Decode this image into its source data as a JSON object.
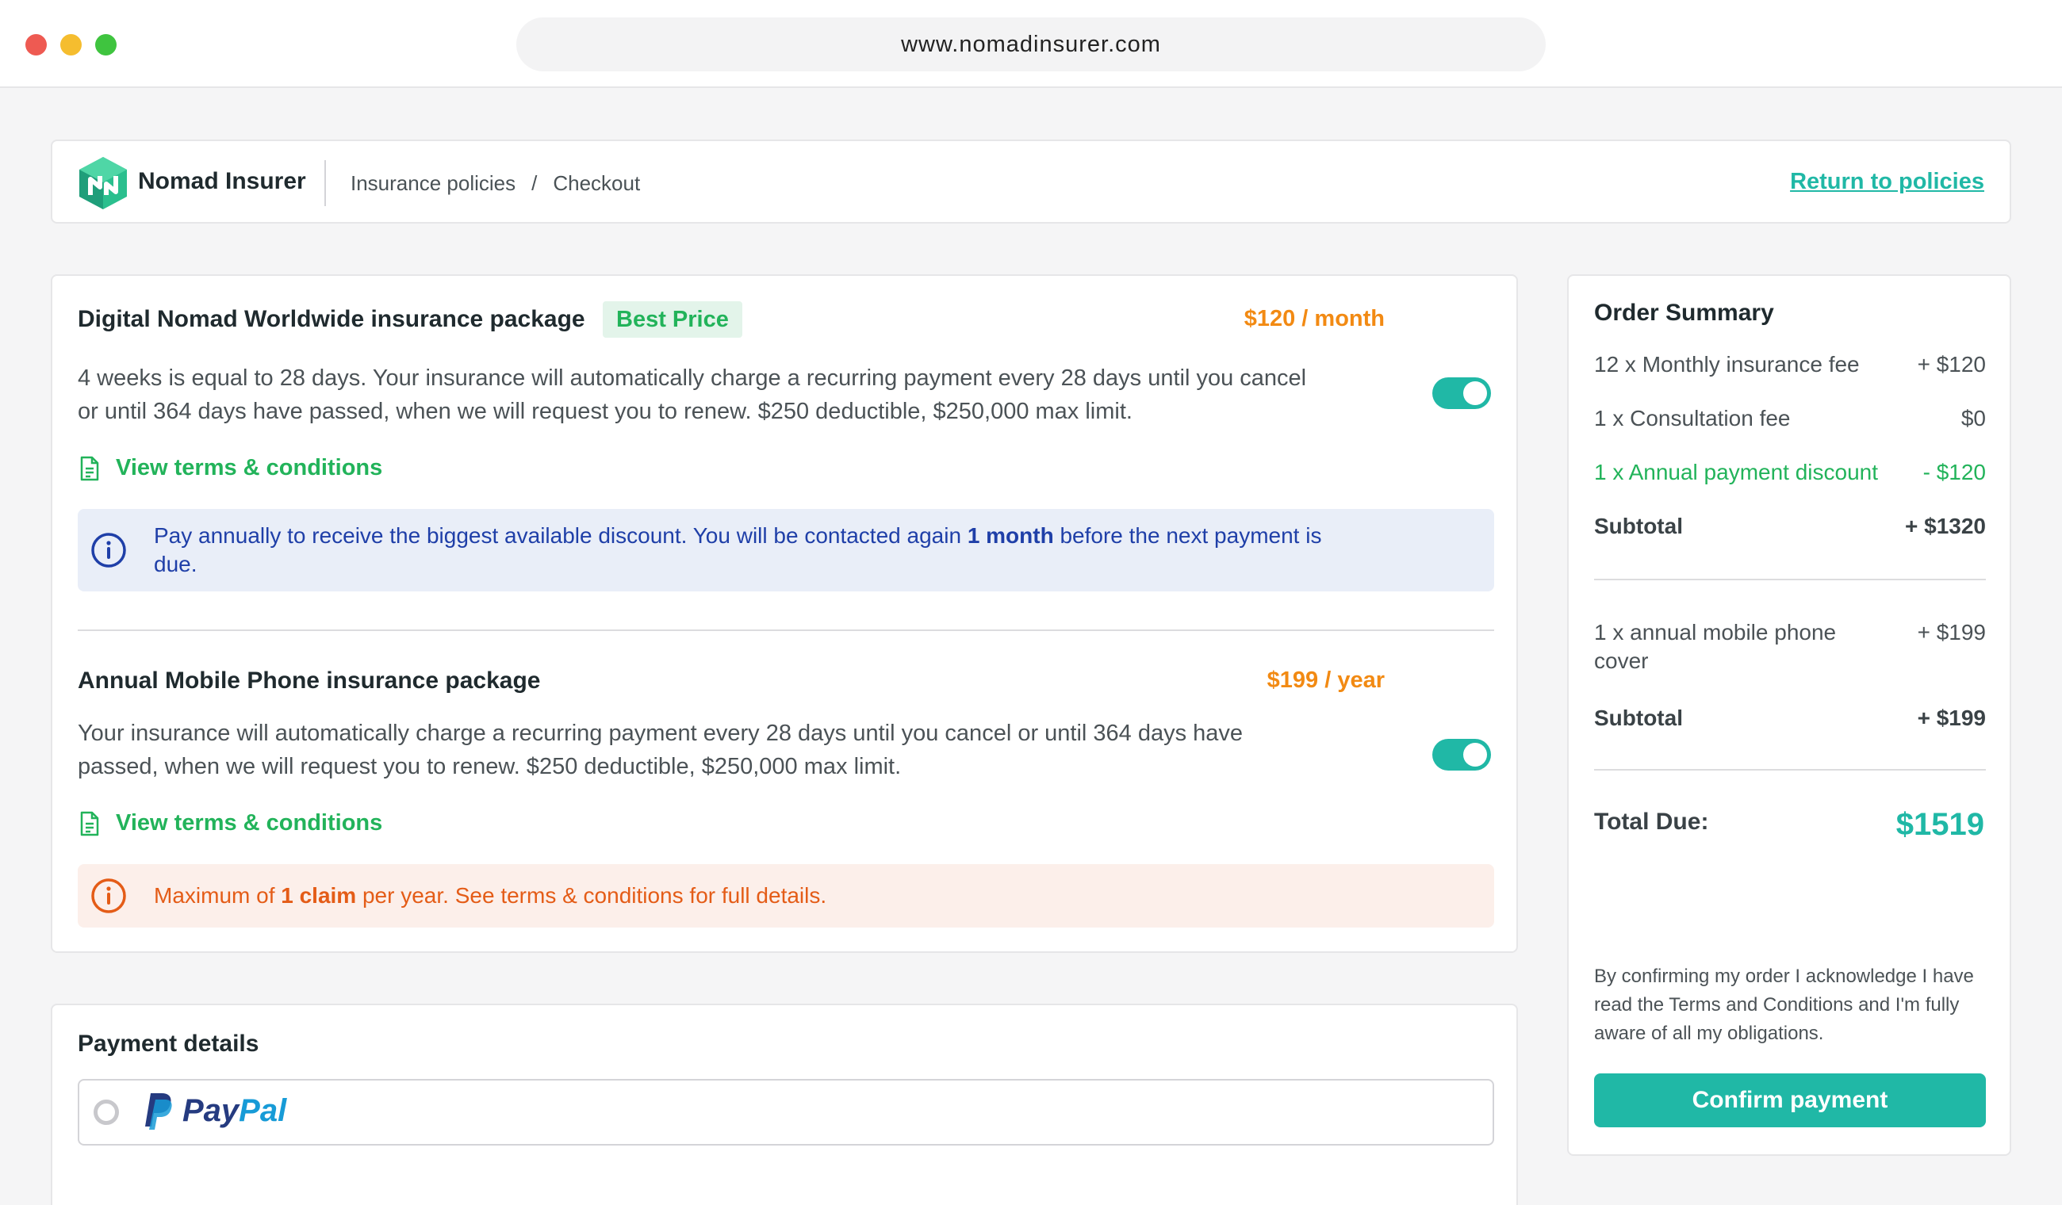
{
  "browser": {
    "url": "www.nomadinsurer.com"
  },
  "header": {
    "brand": "Nomad Insurer",
    "breadcrumb": [
      "Insurance policies",
      "/",
      "Checkout"
    ],
    "return_link": "Return to policies"
  },
  "packages": [
    {
      "title": "Digital Nomad Worldwide insurance package",
      "badge": "Best Price",
      "price": "$120 / month",
      "description_lines": [
        "4 weeks is equal to 28 days. Your insurance will automatically charge a recurring payment every 28 days until you cancel",
        "or until 364 days have passed, when we will request you to renew. $250 deductible, $250,000 max limit."
      ],
      "toggle_on": true,
      "terms_link": "View terms & conditions",
      "notice": {
        "before": "Pay annually to receive the biggest available discount. You will be contacted again ",
        "bold": "1 month",
        "after": " before the next payment is",
        "line2": "due."
      }
    },
    {
      "title": "Annual Mobile Phone insurance package",
      "price": "$199 / year",
      "description_lines": [
        "Your insurance will automatically charge a recurring payment every 28 days until you cancel or until 364 days have",
        "passed, when we will request you to renew. $250 deductible, $250,000 max limit."
      ],
      "toggle_on": true,
      "terms_link": "View terms & conditions",
      "notice": {
        "before": "Maximum of ",
        "bold": "1 claim",
        "after": " per year. See terms & conditions for full details."
      }
    }
  ],
  "payment": {
    "title": "Payment details",
    "option": {
      "label_part1": "Pay",
      "label_part2": "Pal",
      "selected": false
    }
  },
  "summary": {
    "title": "Order Summary",
    "rows": [
      {
        "label": "12 x Monthly insurance fee",
        "amount": "+ $120"
      },
      {
        "label": "1 x Consultation fee",
        "amount": "$0"
      },
      {
        "label": "1 x Annual payment discount",
        "amount": "- $120"
      },
      {
        "label": "Subtotal",
        "amount": "+ $1320"
      },
      {
        "label": "1 x annual mobile phone cover",
        "amount": "+ $199"
      },
      {
        "label": "Subtotal",
        "amount": "+ $199"
      }
    ],
    "total_label": "Total Due:",
    "total_amount": "$1519",
    "acknowledgement": "By confirming my order I acknowledge I have read the Terms and Conditions and I'm fully aware of all my obligations.",
    "confirm_button": "Confirm payment"
  },
  "colors": {
    "accent": "#20b8a6",
    "green": "#22b35a",
    "orange_price": "#f28a13",
    "info_blue": "#1f3fa8",
    "warning_orange": "#e45c17"
  }
}
